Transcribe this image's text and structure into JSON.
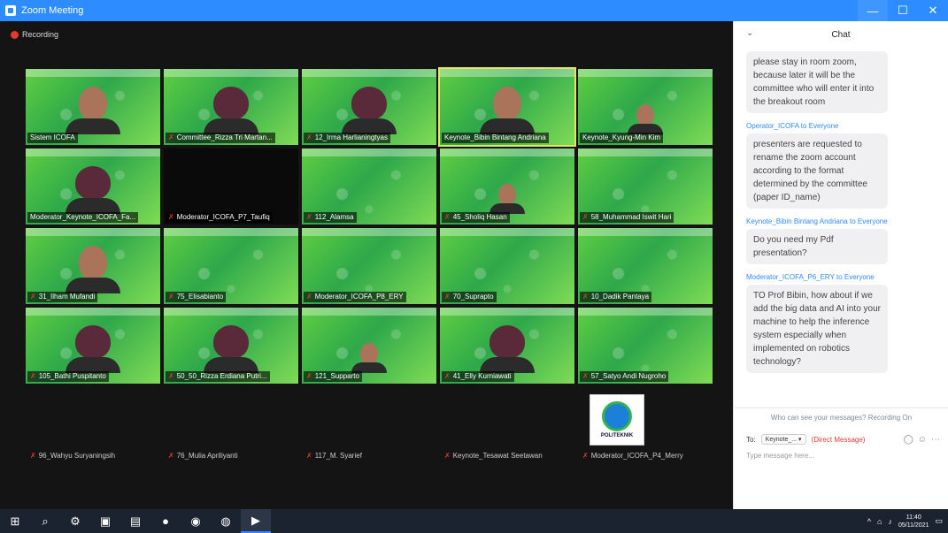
{
  "window": {
    "title": "Zoom Meeting",
    "minimize": "—",
    "maximize": "☐",
    "close": "✕"
  },
  "recording": "Recording",
  "tiles": [
    {
      "name": "Sistem ICOFA",
      "kind": "person",
      "muted": false
    },
    {
      "name": "Committee_Rizza Tri Martan...",
      "kind": "person-hijab",
      "muted": true
    },
    {
      "name": "12_Irma Harlianingtyas",
      "kind": "person-hijab",
      "muted": true
    },
    {
      "name": "Keynote_Bibin Bintang Andriana",
      "kind": "person",
      "muted": false,
      "active": true
    },
    {
      "name": "Keynote_Kyung-Min Kim",
      "kind": "person-small",
      "muted": false
    },
    {
      "name": "Moderator_Keynote_ICOFA_Fa...",
      "kind": "person-hijab",
      "muted": false
    },
    {
      "name": "Moderator_ICOFA_P7_Taufiq",
      "kind": "dark",
      "muted": true
    },
    {
      "name": "112_Alamsa",
      "kind": "bg",
      "muted": true
    },
    {
      "name": "45_Sholiq Hasan",
      "kind": "person-small",
      "muted": true
    },
    {
      "name": "58_Muhammad Iswit Hari",
      "kind": "bg",
      "muted": true
    },
    {
      "name": "31_Ilham Mufandi",
      "kind": "person",
      "muted": true
    },
    {
      "name": "75_Elisabianto",
      "kind": "bg",
      "muted": true
    },
    {
      "name": "Moderator_ICOFA_P8_ERY",
      "kind": "bg",
      "muted": true
    },
    {
      "name": "70_Suprapto",
      "kind": "bg",
      "muted": true
    },
    {
      "name": "10_Dadik Pantaya",
      "kind": "bg",
      "muted": true
    },
    {
      "name": "105_Bathi Puspitanto",
      "kind": "person-hijab",
      "muted": true
    },
    {
      "name": "50_50_Rizza Erdiana Putri...",
      "kind": "person-hijab",
      "muted": true
    },
    {
      "name": "121_Supparto",
      "kind": "person-small",
      "muted": true
    },
    {
      "name": "41_Elly Kurniawati",
      "kind": "person-hijab",
      "muted": true
    },
    {
      "name": "57_Satyo Andi Nugroho",
      "kind": "bg",
      "muted": true
    },
    {
      "name": "96_Wahyu Suryaningsih",
      "kind": "empty",
      "muted": true
    },
    {
      "name": "76_Mulia Apriliyanti",
      "kind": "empty",
      "muted": true
    },
    {
      "name": "117_M. Syarief",
      "kind": "empty",
      "muted": true
    },
    {
      "name": "Keynote_Tesawat Seetawan",
      "kind": "empty",
      "muted": true
    },
    {
      "name": "Moderator_ICOFA_P4_Merry",
      "kind": "logo",
      "muted": true,
      "logo_text": "POLITEKNIK"
    }
  ],
  "chat": {
    "title": "Chat",
    "collapse": "⌄",
    "messages": [
      {
        "sender": "",
        "text": "please stay in room zoom, because later it will be the committee who will enter it into the breakout room"
      },
      {
        "sender": "Operator_ICOFA to Everyone",
        "text": "presenters are requested to rename the zoom account according to the format determined by the committee (paper ID_name)"
      },
      {
        "sender": "Keynote_Bibin Bintang Andriana to Everyone",
        "text": "Do you need my Pdf presentation?"
      },
      {
        "sender": "Moderator_ICOFA_P6_ERY to Everyone",
        "text": "TO Prof Bibin, how about if we add the big data and AI into your machine to help the inference system especially when implemented on robotics technology?"
      }
    ],
    "notice": "Who can see your messages? Recording On",
    "to_label": "To:",
    "to_value": "Keynote_... ▾",
    "direct": "(Direct Message)",
    "placeholder": "Type message here..."
  },
  "taskbar": {
    "clock_time": "11:40",
    "clock_date": "05/11/2021"
  }
}
